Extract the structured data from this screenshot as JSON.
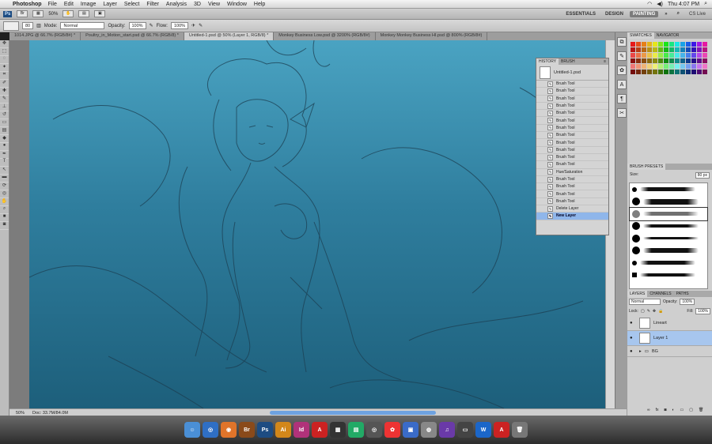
{
  "menubar": {
    "app_name": "Photoshop",
    "items": [
      "File",
      "Edit",
      "Image",
      "Layer",
      "Select",
      "Filter",
      "Analysis",
      "3D",
      "View",
      "Window",
      "Help"
    ],
    "clock": "Thu 4:07 PM"
  },
  "appbar": {
    "ps_logo": "Ps",
    "zoom": "50%",
    "workspaces": [
      "ESSENTIALS",
      "DESIGN",
      "PAINTING"
    ],
    "active_workspace": "PAINTING",
    "cs_live": "CS Live"
  },
  "options": {
    "brush_size": "80",
    "mode_label": "Mode:",
    "mode_value": "Normal",
    "opacity_label": "Opacity:",
    "opacity_value": "100%",
    "flow_label": "Flow:",
    "flow_value": "100%"
  },
  "tabs": [
    "1014.JPG @ 66.7% (RGB/8#) *",
    "Poultry_in_Motion_start.psd @ 66.7% (RGB/8) *",
    "Untitled-1.psd @ 50% (Layer 1, RGB/8) *",
    "Monkey Business Low.psd @ 3200% (RGB/8#)",
    "Monkey Monkey Business HI.psd @ 800% (RGB/8#)"
  ],
  "history": {
    "tabs": [
      "HISTORY",
      "BRUSH"
    ],
    "snapshot": "Untitled-1.psd",
    "rows": [
      "Brush Tool",
      "Brush Tool",
      "Brush Tool",
      "Brush Tool",
      "Brush Tool",
      "Brush Tool",
      "Brush Tool",
      "Brush Tool",
      "Brush Tool",
      "Brush Tool",
      "Brush Tool",
      "Brush Tool",
      "Hue/Saturation",
      "Brush Tool",
      "Brush Tool",
      "Brush Tool",
      "Brush Tool",
      "Delete Layer",
      "New Layer"
    ]
  },
  "swatches": {
    "tabs": [
      "SWATCHES",
      "NAVIGATOR"
    ]
  },
  "brush_presets": {
    "title": "BRUSH PRESETS",
    "size_label": "Size:",
    "size_value": "80 px"
  },
  "layers": {
    "tabs": [
      "LAYERS",
      "CHANNELS",
      "PATHS"
    ],
    "blend": "Normal",
    "opacity_label": "Opacity:",
    "opacity_value": "100%",
    "lock_label": "Lock:",
    "fill_label": "Fill:",
    "fill_value": "100%",
    "rows": [
      "Lineart",
      "Layer 1",
      "BG"
    ]
  },
  "status": {
    "zoom": "50%",
    "doc": "Doc: 33.7M/84.0M"
  },
  "dock_apps": [
    "Finder",
    "Safari",
    "Firefox",
    "Br",
    "Ps",
    "Ai",
    "Id",
    "Acrobat",
    "iTunes",
    "iPhoto",
    "Mail",
    "Word",
    "Illustrator"
  ]
}
